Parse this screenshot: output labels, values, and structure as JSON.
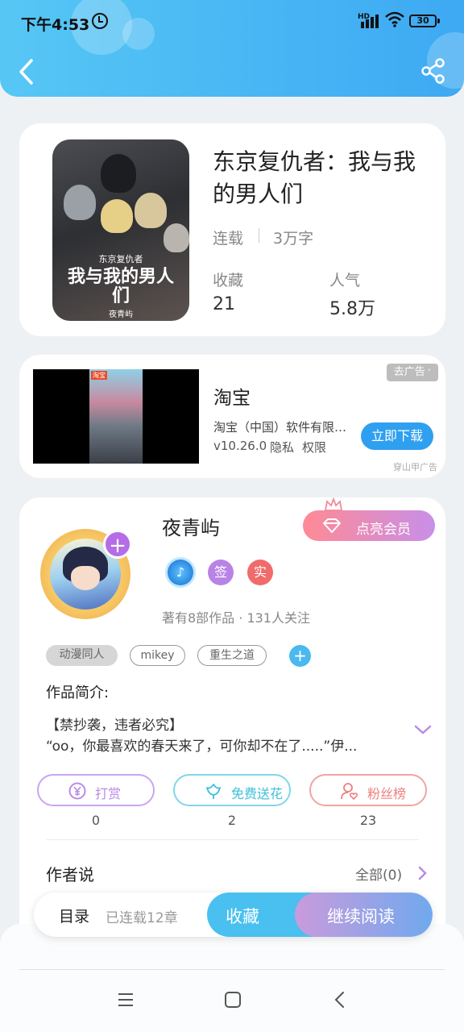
{
  "status_bar": {
    "time": "下午4:53",
    "network": "HD",
    "battery": "30"
  },
  "book": {
    "title": "东京复仇者：我与我的男人们",
    "status": "连载",
    "word_count": "3万字",
    "cover_series": "东京复仇者",
    "cover_title": "我与我的男人们",
    "cover_author": "夜青屿",
    "favorites_label": "收藏",
    "favorites_value": "21",
    "popularity_label": "人气",
    "popularity_value": "5.8万"
  },
  "ad": {
    "close_label": "去广告",
    "title": "淘宝",
    "company": "淘宝（中国）软件有限公司",
    "version": "v10.26.0",
    "privacy": "隐私",
    "permissions": "权限",
    "download_label": "立即下载",
    "source": "穿山甲广告",
    "thumb_tag": "淘宝"
  },
  "author": {
    "name": "夜青屿",
    "vip_label": "点亮会员",
    "badge_sign": "签",
    "badge_real": "实",
    "stats": "著有8部作品 · 131人关注",
    "tags": [
      "动漫同人",
      "mikey",
      "重生之道"
    ],
    "intro_title": "作品简介:",
    "intro_line1": "【禁抄袭，违者必究】",
    "intro_line2": "“oo，你最喜欢的春天来了，可你却不在了.....”伊...",
    "actions": [
      {
        "label": "打赏",
        "count": "0"
      },
      {
        "label": "免费送花",
        "count": "2"
      },
      {
        "label": "粉丝榜",
        "count": "23"
      }
    ],
    "author_says_title": "作者说",
    "author_says_more": "全部(0)"
  },
  "bottom_bar": {
    "toc_label": "目录",
    "toc_sub": "已连载12章",
    "favorite_label": "收藏",
    "read_label": "继续阅读"
  },
  "colors": {
    "header": "#3da9f3",
    "accent_blue": "#49c0ef",
    "reward_purple": "#b98be6",
    "flower_cyan": "#49c6de",
    "fans_red": "#ef7f7f"
  }
}
